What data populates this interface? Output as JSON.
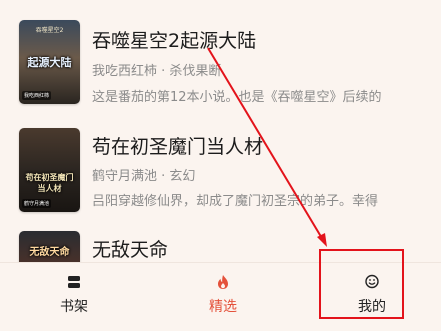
{
  "books": [
    {
      "title": "吞噬星空2起源大陆",
      "meta": "我吃西红柿 · 杀伐果断",
      "desc": "这是番茄的第12本小说。也是《吞噬星空》后续的",
      "cover": {
        "text": "起源大陆",
        "label": "吞噬星空2",
        "badge": "我吃西红柿"
      }
    },
    {
      "title": "苟在初圣魔门当人材",
      "meta": "鹤守月满池 · 玄幻",
      "desc": "吕阳穿越修仙界，却成了魔门初圣宗的弟子。幸得",
      "cover": {
        "text": "苟在初圣魔门当人材",
        "badge": "鹤守月满池"
      }
    },
    {
      "title": "无敌天命",
      "cover": {
        "text": "无敌天命"
      }
    }
  ],
  "tabbar": {
    "tabs": [
      {
        "label": "书架",
        "icon": "bookshelf-icon"
      },
      {
        "label": "精选",
        "icon": "flame-icon",
        "active": true
      },
      {
        "label": "我的",
        "icon": "smile-icon"
      }
    ]
  },
  "colors": {
    "accent": "#e4513b",
    "annotation": "#e3131b",
    "background": "#fbf4ef"
  }
}
